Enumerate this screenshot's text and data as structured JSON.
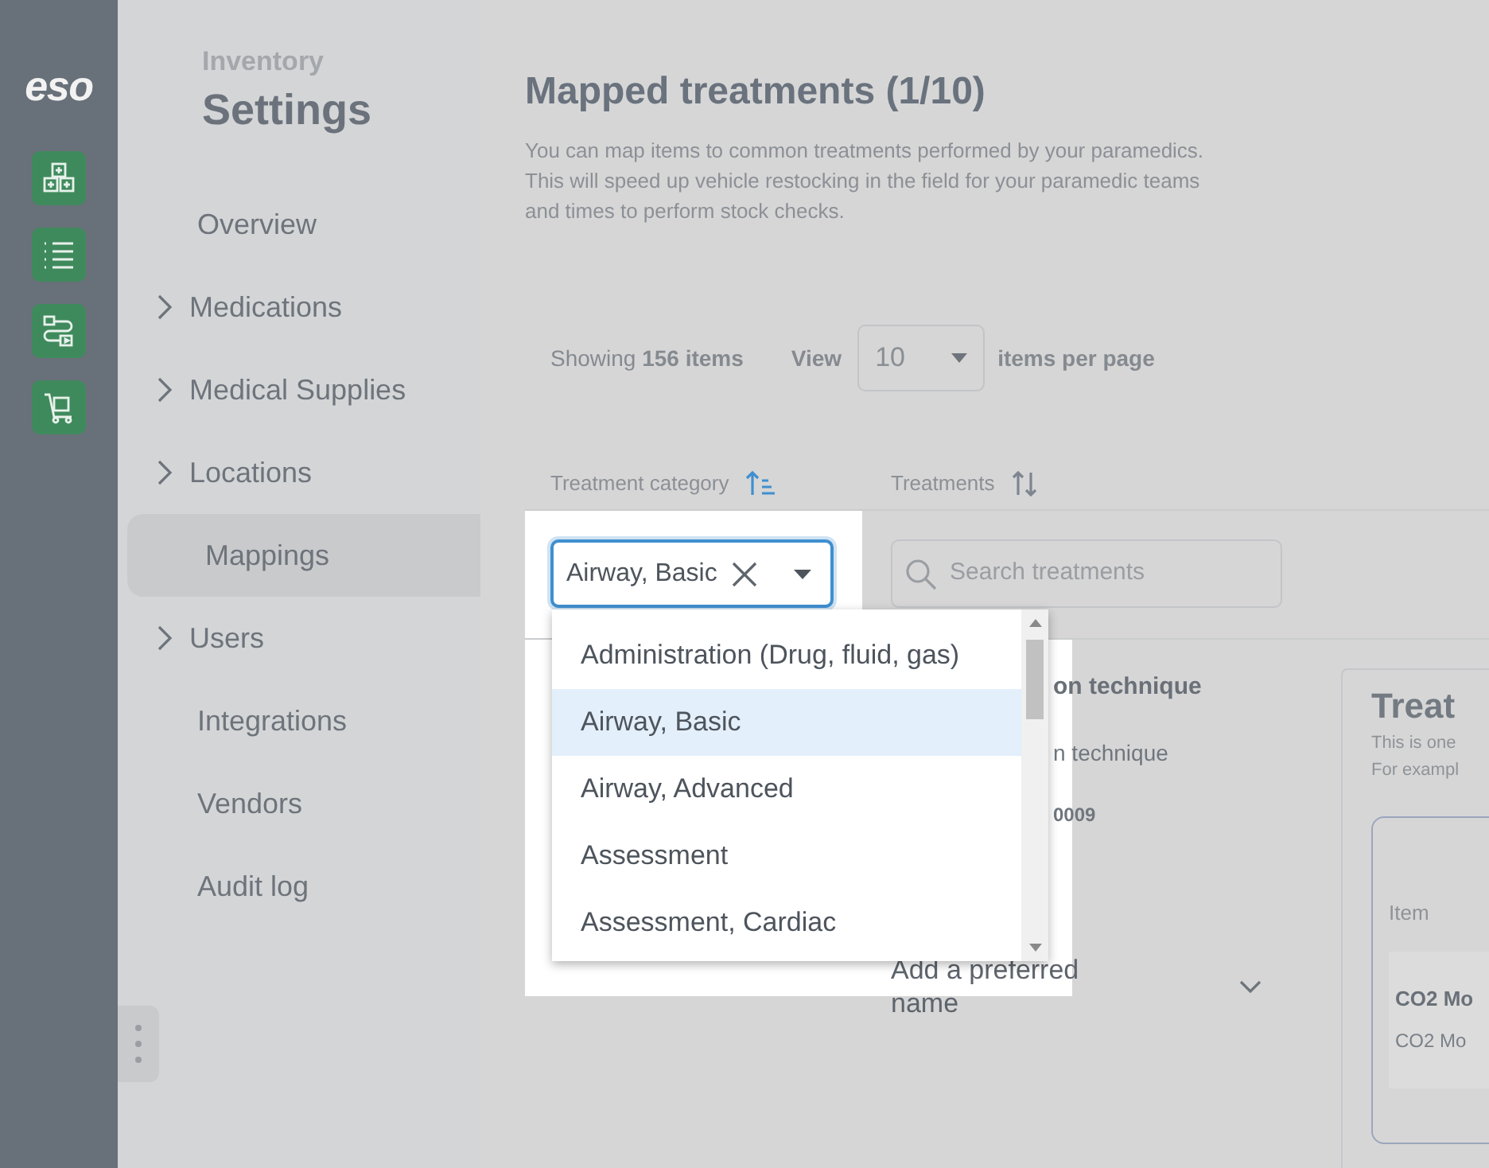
{
  "rail": {
    "logo": "eso"
  },
  "sidebar": {
    "eyebrow": "Inventory",
    "title": "Settings",
    "items": [
      {
        "label": "Overview",
        "expandable": false,
        "selected": false
      },
      {
        "label": "Medications",
        "expandable": true,
        "selected": false
      },
      {
        "label": "Medical Supplies",
        "expandable": true,
        "selected": false
      },
      {
        "label": "Locations",
        "expandable": true,
        "selected": false
      },
      {
        "label": "Mappings",
        "expandable": false,
        "selected": true
      },
      {
        "label": "Users",
        "expandable": true,
        "selected": false
      },
      {
        "label": "Integrations",
        "expandable": false,
        "selected": false
      },
      {
        "label": "Vendors",
        "expandable": false,
        "selected": false
      },
      {
        "label": "Audit log",
        "expandable": false,
        "selected": false
      }
    ]
  },
  "page": {
    "title": "Mapped treatments (1/10)",
    "description": "You can map items to common treatments performed by your paramedics. This will speed up vehicle restocking in the field for your paramedic teams and times to perform stock checks.",
    "showing": "Showing **156 items**",
    "view_label": "View",
    "per_page": "10",
    "per_page_suffix": "items per page"
  },
  "columns": [
    {
      "label": "Treatment category",
      "sorted": true
    },
    {
      "label": "Treatments",
      "sorted": false
    }
  ],
  "category_filter": {
    "value": "Airway, Basic"
  },
  "search": {
    "placeholder": "Search treatments"
  },
  "dropdown": {
    "options": [
      {
        "label": "Administration (Drug, fluid, gas)",
        "selected": false
      },
      {
        "label": "Airway, Basic",
        "selected": true
      },
      {
        "label": "Airway, Advanced",
        "selected": false
      },
      {
        "label": "Assessment",
        "selected": false
      },
      {
        "label": "Assessment, Cardiac",
        "selected": false
      }
    ]
  },
  "row": {
    "cells": [
      "on technique",
      "n technique",
      "0009"
    ],
    "preferred_name": "Add a preferred name"
  },
  "detail_card": {
    "title": "Treat",
    "lines": [
      "This is one",
      "For exampl"
    ],
    "column": "Item",
    "item_title": "CO2 Mo",
    "item_subtitle": "CO2 Mo"
  }
}
